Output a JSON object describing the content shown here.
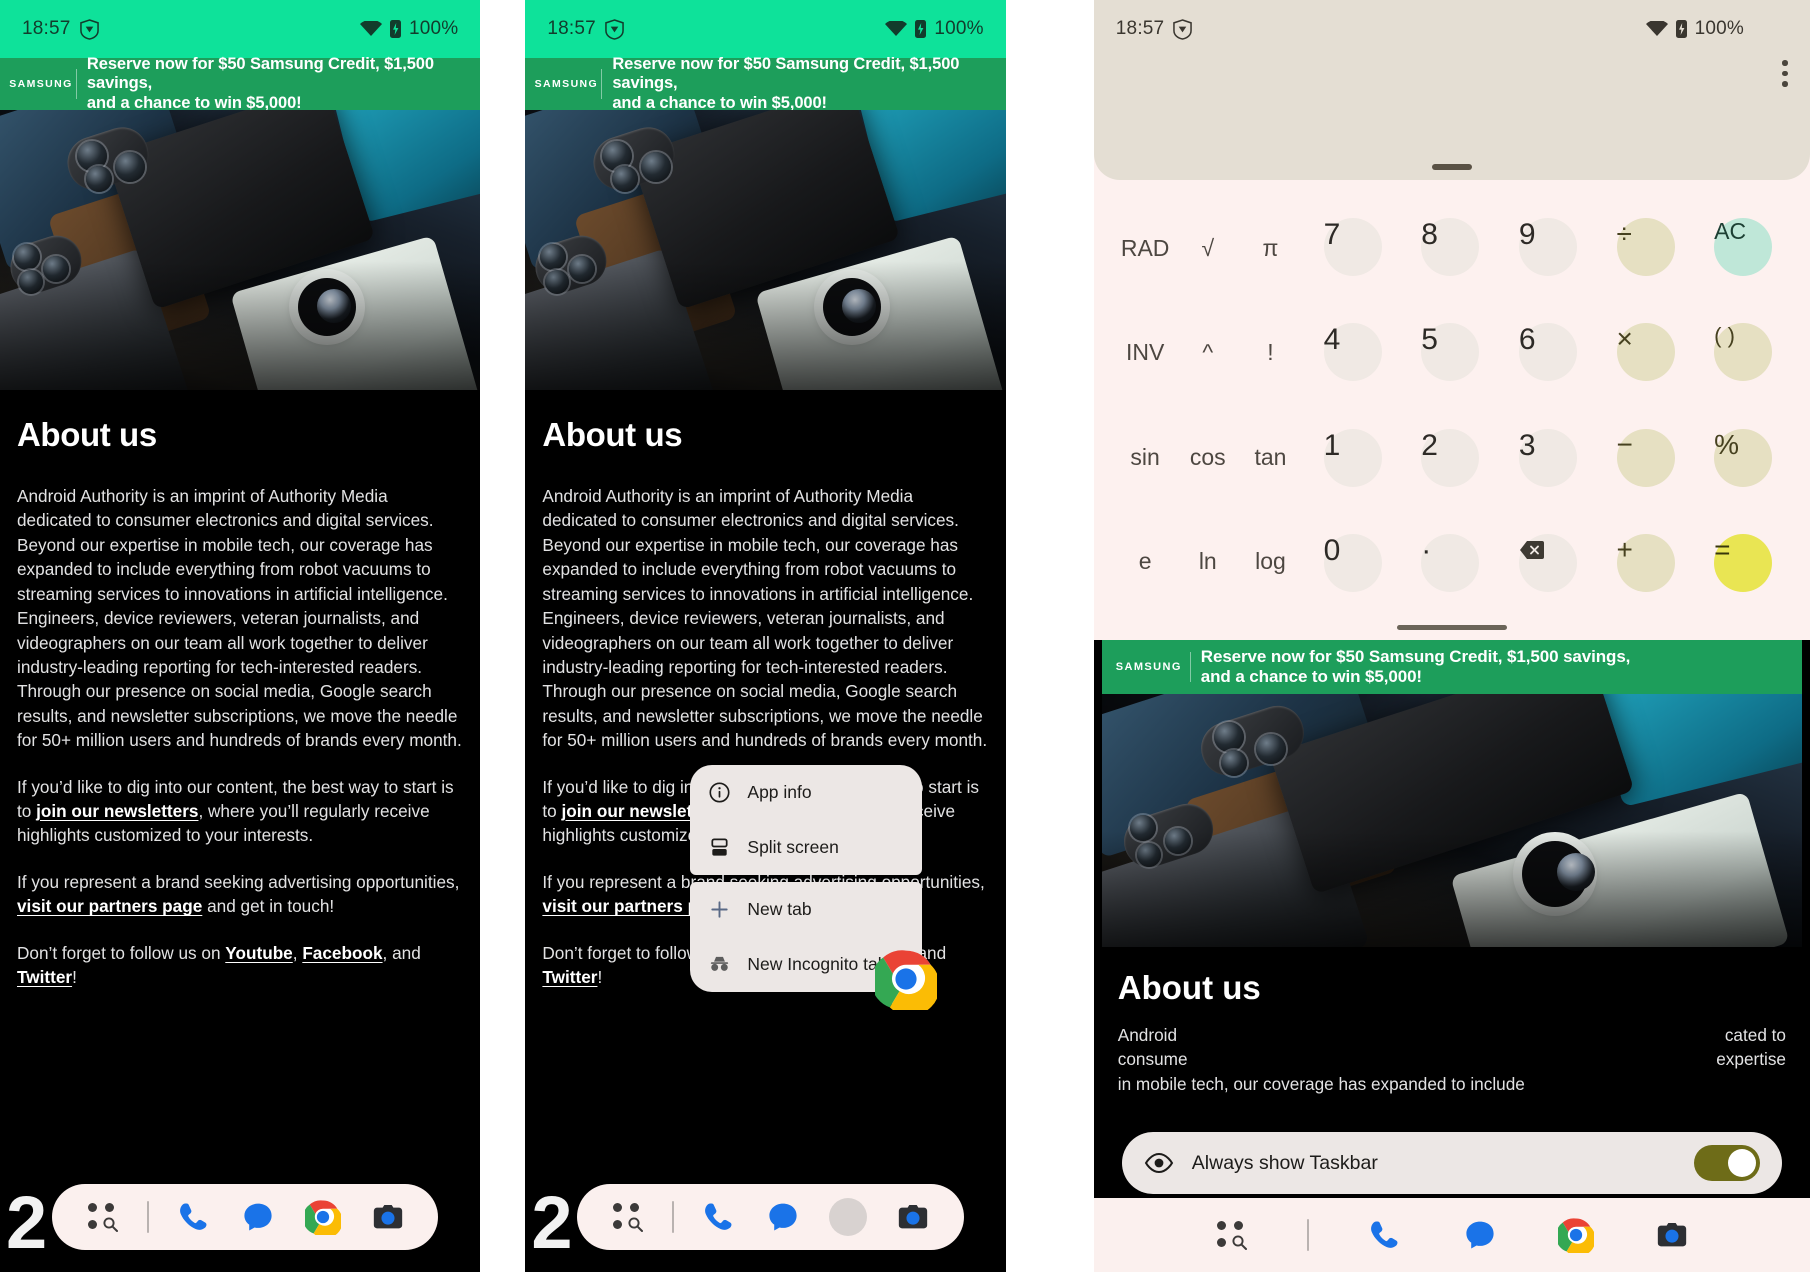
{
  "status_bar": {
    "time": "18:57",
    "battery_percent": "100%",
    "icons": [
      "vpn-shield-icon",
      "wifi-icon",
      "battery-icon"
    ]
  },
  "ad_banner": {
    "brand": "SAMSUNG",
    "line1": "Reserve now for $50 Samsung Credit, $1,500 savings,",
    "line2": "and a chance to win $5,000!",
    "bg_color": "#1d9e5b"
  },
  "article": {
    "title": "About us",
    "p1": "Android Authority is an imprint of Authority Media dedicated to consumer electronics and digital services. Beyond our expertise in mobile tech, our coverage has expanded to include everything from robot vacuums to streaming services to innovations in artificial intelligence. Engineers, device reviewers, veteran journalists, and videographers on our team all work together to deliver industry-leading reporting for tech-interested readers. Through our presence on social media, Google search results, and newsletter subscriptions, we move the needle for 50+ million users and hundreds of brands every month.",
    "p2_pre": "If you’d like to dig into our content, the best way to start is to ",
    "p2_link": "join our newsletters",
    "p2_post": ", where you’ll regularly receive highlights customized to your interests.",
    "p3_pre": "If you represent a brand seeking advertising opportunities, ",
    "p3_link": "visit our partners page",
    "p3_post": " and get in touch!",
    "p4_pre": "Don’t forget to follow us on ",
    "p4_link1": "Youtube",
    "p4_sep1": ", ",
    "p4_link2": "Facebook",
    "p4_sep2": ", and ",
    "p4_link3": "Twitter",
    "p4_post": "!"
  },
  "article_panel3": {
    "title": "About us",
    "line1_a": "Android",
    "line1_b": "cated to",
    "line2_a": "consume",
    "line2_b": "expertise",
    "line3": "in mobile tech, our coverage has expanded to include"
  },
  "overlay_number": "2",
  "taskbar": {
    "items": [
      {
        "name": "app-drawer-icon",
        "label": "All apps"
      },
      {
        "name": "taskbar-divider",
        "label": ""
      },
      {
        "name": "phone-icon",
        "label": "Phone"
      },
      {
        "name": "messages-icon",
        "label": "Messages"
      },
      {
        "name": "chrome-icon",
        "label": "Chrome"
      },
      {
        "name": "camera-icon",
        "label": "Camera"
      }
    ]
  },
  "context_menu": {
    "groups": [
      {
        "items": [
          {
            "icon": "info-icon",
            "label": "App info"
          },
          {
            "icon": "split-screen-icon",
            "label": "Split screen"
          }
        ]
      },
      {
        "items": [
          {
            "icon": "plus-icon",
            "label": "New tab"
          },
          {
            "icon": "incognito-icon",
            "label": "New Incognito tab"
          }
        ]
      }
    ]
  },
  "calculator": {
    "display_value": "",
    "kebab_label": "More options",
    "function_keys": [
      "RAD",
      "√",
      "π",
      "INV",
      "^",
      "!",
      "sin",
      "cos",
      "tan",
      "e",
      "ln",
      "log"
    ],
    "rows": [
      [
        {
          "label": "7",
          "type": "digit"
        },
        {
          "label": "8",
          "type": "digit"
        },
        {
          "label": "9",
          "type": "digit"
        },
        {
          "label": "÷",
          "type": "op"
        },
        {
          "label": "AC",
          "type": "ac"
        }
      ],
      [
        {
          "label": "4",
          "type": "digit"
        },
        {
          "label": "5",
          "type": "digit"
        },
        {
          "label": "6",
          "type": "digit"
        },
        {
          "label": "×",
          "type": "op"
        },
        {
          "label": "( )",
          "type": "op"
        }
      ],
      [
        {
          "label": "1",
          "type": "digit"
        },
        {
          "label": "2",
          "type": "digit"
        },
        {
          "label": "3",
          "type": "digit"
        },
        {
          "label": "−",
          "type": "op"
        },
        {
          "label": "%",
          "type": "op"
        }
      ],
      [
        {
          "label": "0",
          "type": "digit"
        },
        {
          "label": "·",
          "type": "digit"
        },
        {
          "label": "backspace-icon",
          "type": "backspace"
        },
        {
          "label": "+",
          "type": "op"
        },
        {
          "label": "=",
          "type": "eq"
        }
      ]
    ],
    "colors": {
      "display_bg": "#e4ded3",
      "pad_bg": "#fdf1ef",
      "op_bg": "#e6e0c2",
      "ac_bg": "#bfe7d8",
      "eq_bg": "#e9e553"
    }
  },
  "toast": {
    "icon": "eye-icon",
    "label": "Always show Taskbar",
    "toggle_on": true,
    "toggle_color": "#6e6c18"
  }
}
